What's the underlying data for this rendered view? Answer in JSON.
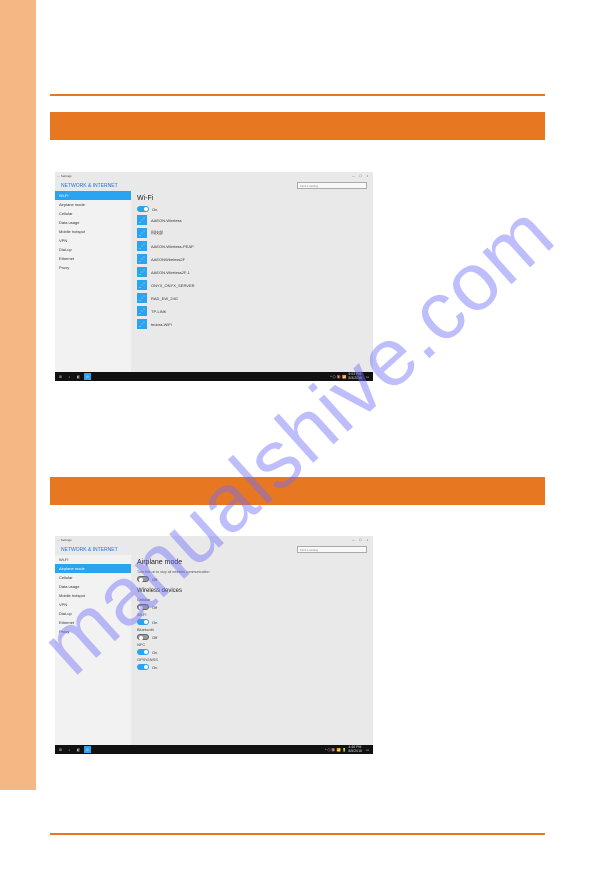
{
  "watermark": "manualshive.com",
  "screenshot1": {
    "titlebar_left": "← Settings",
    "header_title": "NETWORK & INTERNET",
    "search_placeholder": "Find a setting",
    "sidebar": [
      {
        "label": "Wi-Fi",
        "active": true
      },
      {
        "label": "Airplane mode",
        "active": false
      },
      {
        "label": "Cellular",
        "active": false
      },
      {
        "label": "Data usage",
        "active": false
      },
      {
        "label": "Mobile hotspot",
        "active": false
      },
      {
        "label": "VPN",
        "active": false
      },
      {
        "label": "Dial-up",
        "active": false
      },
      {
        "label": "Ethernet",
        "active": false
      },
      {
        "label": "Proxy",
        "active": false
      }
    ],
    "panel_title": "Wi-Fi",
    "toggle_state": "On",
    "networks": [
      "AAEON-Wireless",
      "科技部",
      "AAEON-Wireless-PEAP",
      "AAEONWireless2F",
      "AAEON-Wireless2F-1",
      "ONYX_ONYX_SERVER",
      "RAD_EW_24G",
      "TP-LINK",
      "fedora-WiFi"
    ],
    "taskbar_time": "9:03 PM",
    "taskbar_date": "8/3/2016"
  },
  "screenshot2": {
    "titlebar_left": "← Settings",
    "header_title": "NETWORK & INTERNET",
    "search_placeholder": "Find a setting",
    "sidebar": [
      {
        "label": "Wi-Fi",
        "active": false
      },
      {
        "label": "Airplane mode",
        "active": true
      },
      {
        "label": "Cellular",
        "active": false
      },
      {
        "label": "Data usage",
        "active": false
      },
      {
        "label": "Mobile hotspot",
        "active": false
      },
      {
        "label": "VPN",
        "active": false
      },
      {
        "label": "Dial-up",
        "active": false
      },
      {
        "label": "Ethernet",
        "active": false
      },
      {
        "label": "Proxy",
        "active": false
      }
    ],
    "panel_title": "Airplane mode",
    "helper": "Turn this on to stop all wireless communication",
    "toggle_state": "Off",
    "subtitle": "Wireless devices",
    "devices": [
      {
        "name": "Cellular",
        "state": "Off"
      },
      {
        "name": "Wi-Fi",
        "state": "On"
      },
      {
        "name": "Bluetooth",
        "state": "Off"
      },
      {
        "name": "NFC",
        "state": "On"
      },
      {
        "name": "GPS\\GNSS",
        "state": "On"
      }
    ],
    "taskbar_time": "4:46 PM",
    "taskbar_date": "8/5/2016"
  }
}
